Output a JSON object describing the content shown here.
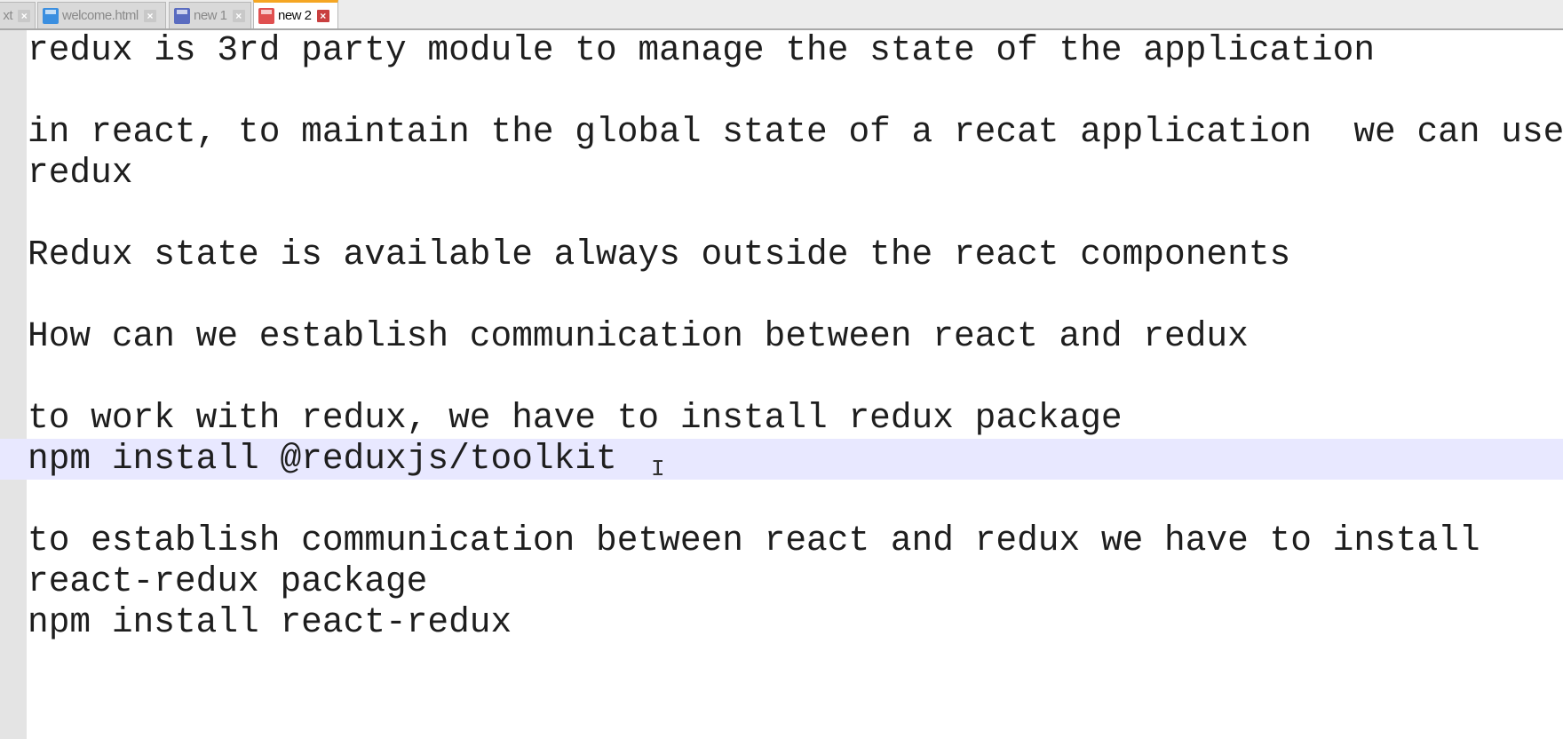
{
  "tabs": [
    {
      "label": "xt",
      "icon": "disk-icon",
      "color": "#3b7fd6",
      "active": false
    },
    {
      "label": "welcome.html",
      "icon": "disk-icon",
      "color": "#3b8fe0",
      "active": false
    },
    {
      "label": "new 1",
      "icon": "disk-icon",
      "color": "#5a6cc0",
      "active": false
    },
    {
      "label": "new 2",
      "icon": "disk-icon",
      "color": "#e05050",
      "active": true
    }
  ],
  "editor": {
    "lines": [
      "redux is 3rd party module to manage the state of the application",
      "",
      "in react, to maintain the global state of a recat application  we can use",
      "redux",
      "",
      "Redux state is available always outside the react components",
      "",
      "How can we establish communication between react and redux",
      "",
      "to work with redux, we have to install redux package",
      "npm install @reduxjs/toolkit ",
      "",
      "to establish communication between react and redux we have to install",
      "react-redux package",
      "npm install react-redux"
    ],
    "current_line_index": 10,
    "highlight_color": "#e8e8ff"
  }
}
